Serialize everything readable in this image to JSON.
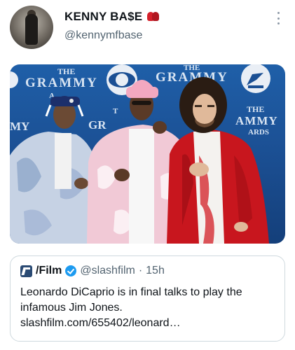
{
  "tweet": {
    "display_name": "KENNY BA$E",
    "handle": "@kennymfbase",
    "name_emoji": "boxing-glove-icon",
    "more_icon": "more-vertical-icon"
  },
  "media": {
    "backdrop_text": {
      "the_left": "THE",
      "grammy_left": "GRAMMY",
      "aw_left": "A",
      "my_left": "MY",
      "the_center": "T",
      "gr_center": "GR",
      "the_top_right": "THE",
      "grammy_right": "GRAMMY",
      "the_far_right": "THE",
      "ammy_far_right": "AMMY",
      "ards_far_right": "ARDS"
    }
  },
  "quote": {
    "name": "/Film",
    "handle": "@slashfilm",
    "separator": "·",
    "time": "15h",
    "text_line1": "Leonardo DiCaprio is in final talks to play the",
    "text_line2": "infamous Jim Jones.",
    "text_line3": "slashfilm.com/655402/leonard…"
  },
  "colors": {
    "accent_verified": "#1d9bf0",
    "glove": "#d4202a",
    "backdrop": "#1b4f93"
  }
}
